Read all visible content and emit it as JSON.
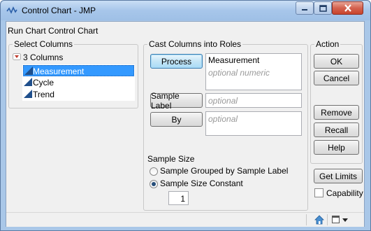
{
  "window": {
    "title": "Control Chart - JMP"
  },
  "report_title": "Run Chart Control Chart",
  "select_columns": {
    "legend": "Select Columns",
    "count_label": "3 Columns",
    "columns": [
      {
        "name": "Measurement",
        "selected": true
      },
      {
        "name": "Cycle",
        "selected": false
      },
      {
        "name": "Trend",
        "selected": false
      }
    ]
  },
  "cast_columns": {
    "legend": "Cast Columns into Roles",
    "process": {
      "button": "Process",
      "value": "Measurement",
      "placeholder": "optional numeric"
    },
    "sample_label": {
      "button": "Sample Label",
      "placeholder": "optional"
    },
    "by": {
      "button": "By",
      "placeholder": "optional"
    }
  },
  "sample_size": {
    "label": "Sample Size",
    "options": [
      {
        "label": "Sample Grouped by Sample Label",
        "checked": false
      },
      {
        "label": "Sample Size Constant",
        "checked": true
      }
    ],
    "constant_value": "1"
  },
  "action": {
    "legend": "Action",
    "ok": "OK",
    "cancel": "Cancel",
    "remove": "Remove",
    "recall": "Recall",
    "help": "Help"
  },
  "get_limits": "Get Limits",
  "capability": {
    "label": "Capability",
    "checked": false
  },
  "colors": {
    "selection": "#3399ff",
    "accent": "#c0392b"
  }
}
